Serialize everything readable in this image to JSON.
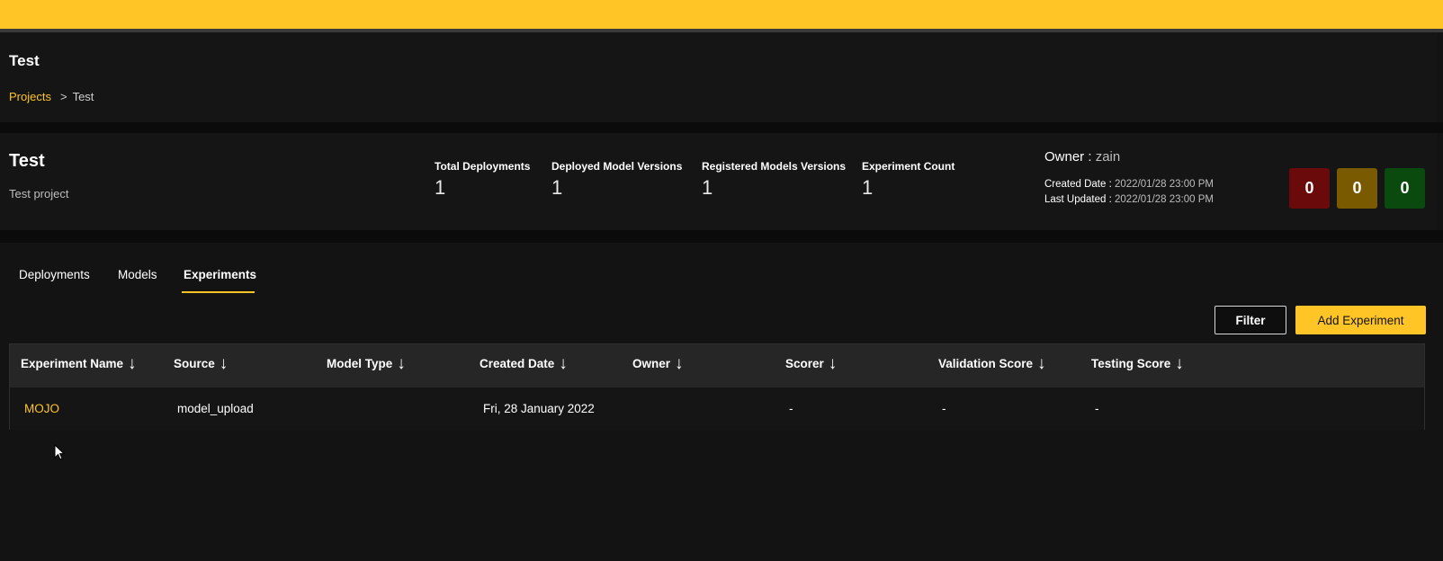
{
  "header": {
    "title": "Test",
    "breadcrumb": {
      "root": "Projects",
      "separator": ">",
      "current": "Test"
    }
  },
  "project": {
    "name": "Test",
    "description": "Test project",
    "stats": [
      {
        "label": "Total Deployments",
        "value": "1"
      },
      {
        "label": "Deployed Model Versions",
        "value": "1"
      },
      {
        "label": "Registered Models Versions",
        "value": "1"
      },
      {
        "label": "Experiment Count",
        "value": "1"
      }
    ],
    "owner_label": "Owner :",
    "owner": "zain",
    "created_label": "Created Date :",
    "created": "2022/01/28 23:00 PM",
    "updated_label": "Last Updated :",
    "updated": "2022/01/28 23:00 PM",
    "badges": [
      {
        "value": "0",
        "color": "#6b0a0a"
      },
      {
        "value": "0",
        "color": "#7a5a00"
      },
      {
        "value": "0",
        "color": "#0b4a0f"
      }
    ]
  },
  "tabs": [
    {
      "label": "Deployments"
    },
    {
      "label": "Models"
    },
    {
      "label": "Experiments"
    }
  ],
  "active_tab": "Experiments",
  "toolbar": {
    "filter_label": "Filter",
    "add_label": "Add Experiment"
  },
  "table": {
    "columns": [
      "Experiment Name",
      "Source",
      "Model Type",
      "Created Date",
      "Owner",
      "Scorer",
      "Validation Score",
      "Testing Score"
    ],
    "sort_icon": "↓",
    "rows": [
      {
        "name": "MOJO",
        "source": "model_upload",
        "model_type": "",
        "created": "Fri, 28 January 2022",
        "owner": "",
        "scorer": "-",
        "validation": "-",
        "testing": "-"
      }
    ]
  },
  "colors": {
    "accent": "#ffc526",
    "background": "#131313",
    "panel": "#151515",
    "table_header": "#262626"
  }
}
